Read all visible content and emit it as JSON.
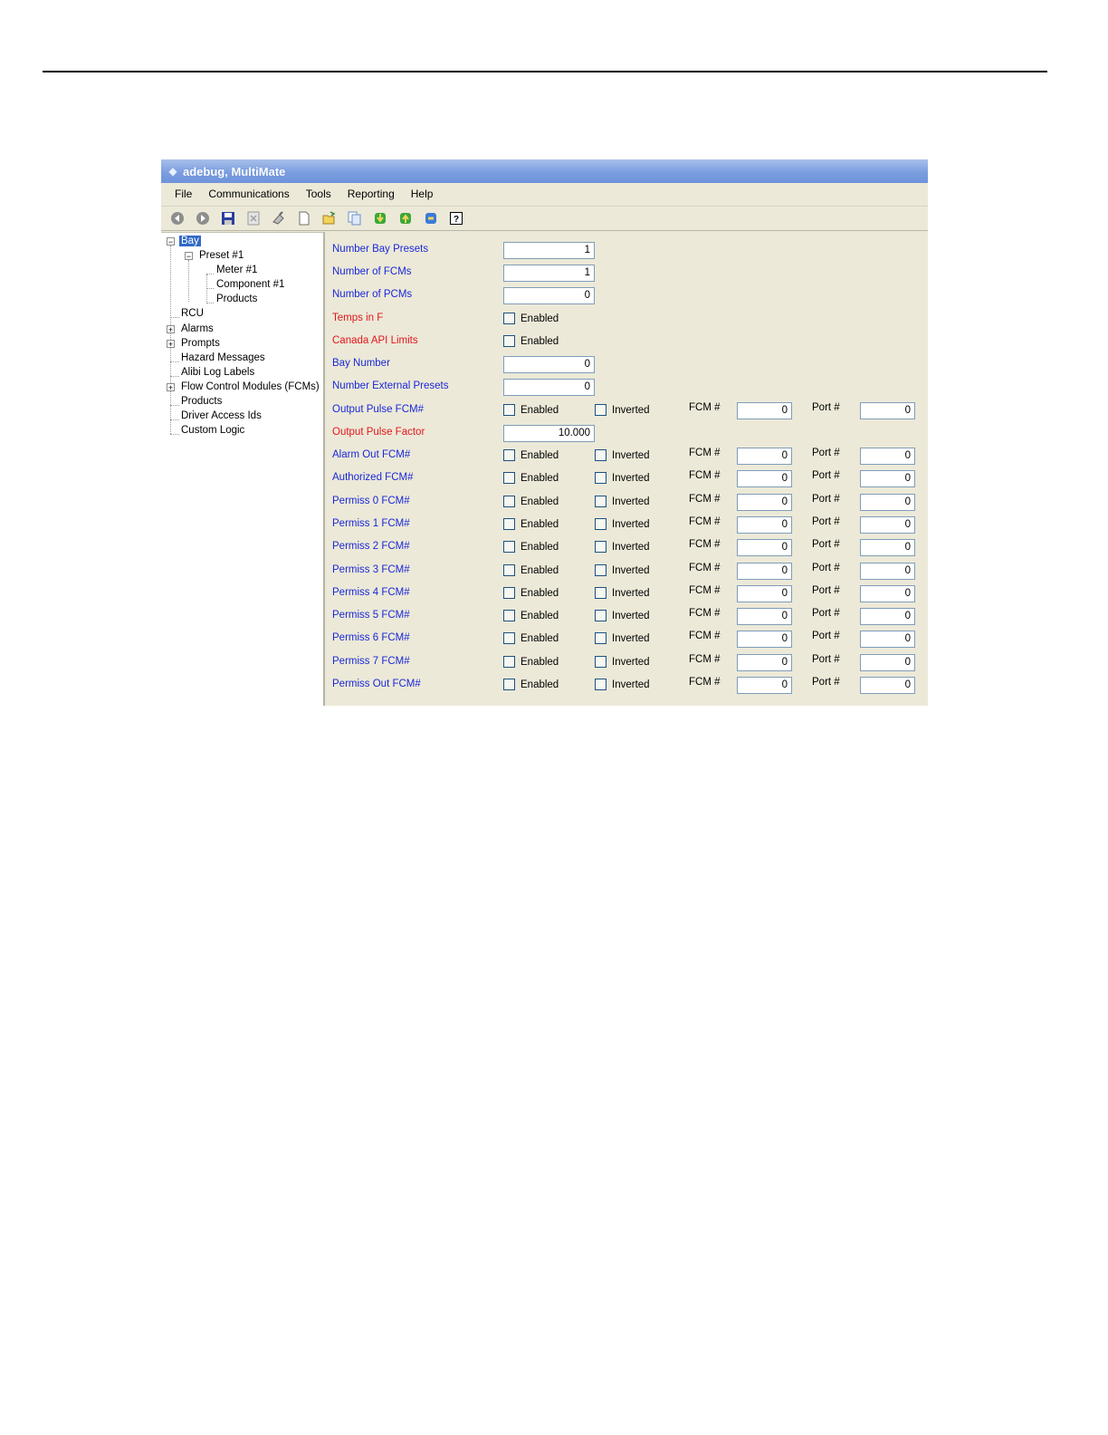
{
  "window": {
    "title": "adebug, MultiMate"
  },
  "menu": [
    "File",
    "Communications",
    "Tools",
    "Reporting",
    "Help"
  ],
  "toolbar": [
    "back-icon",
    "forward-icon",
    "save-icon",
    "delete-icon",
    "clear-icon",
    "new-icon",
    "open-icon",
    "copy-icon",
    "download-icon",
    "upload-icon",
    "connect-icon",
    "help-icon"
  ],
  "tree": {
    "bay": "Bay",
    "preset": "Preset #1",
    "meter": "Meter #1",
    "component": "Component #1",
    "preset_products": "Products",
    "rcu": "RCU",
    "alarms": "Alarms",
    "prompts": "Prompts",
    "hazard": "Hazard Messages",
    "alibi": "Alibi Log Labels",
    "fcms": "Flow Control Modules (FCMs)",
    "products": "Products",
    "driver": "Driver Access Ids",
    "custom": "Custom Logic"
  },
  "labels": {
    "enabled": "Enabled",
    "inverted": "Inverted",
    "fcm": "FCM #",
    "port": "Port #"
  },
  "fields": {
    "number_bay_presets": {
      "label": "Number Bay Presets",
      "value": "1"
    },
    "number_fcms": {
      "label": "Number of FCMs",
      "value": "1"
    },
    "number_pcms": {
      "label": "Number of PCMs",
      "value": "0"
    },
    "temps_in_f": {
      "label": "Temps in F"
    },
    "canada_api": {
      "label": "Canada API Limits"
    },
    "bay_number": {
      "label": "Bay Number",
      "value": "0"
    },
    "number_ext_presets": {
      "label": "Number External Presets",
      "value": "0"
    },
    "output_pulse_factor": {
      "label": "Output Pulse Factor",
      "value": "10.000"
    }
  },
  "fcm_rows": [
    {
      "label": "Output Pulse FCM#",
      "fcm": "0",
      "port": "0"
    },
    {
      "label": "Alarm Out FCM#",
      "fcm": "0",
      "port": "0"
    },
    {
      "label": "Authorized FCM#",
      "fcm": "0",
      "port": "0"
    },
    {
      "label": "Permiss 0 FCM#",
      "fcm": "0",
      "port": "0"
    },
    {
      "label": "Permiss 1 FCM#",
      "fcm": "0",
      "port": "0"
    },
    {
      "label": "Permiss 2 FCM#",
      "fcm": "0",
      "port": "0"
    },
    {
      "label": "Permiss 3 FCM#",
      "fcm": "0",
      "port": "0"
    },
    {
      "label": "Permiss 4 FCM#",
      "fcm": "0",
      "port": "0"
    },
    {
      "label": "Permiss 5 FCM#",
      "fcm": "0",
      "port": "0"
    },
    {
      "label": "Permiss 6 FCM#",
      "fcm": "0",
      "port": "0"
    },
    {
      "label": "Permiss 7 FCM#",
      "fcm": "0",
      "port": "0"
    },
    {
      "label": "Permiss Out FCM#",
      "fcm": "0",
      "port": "0"
    }
  ]
}
